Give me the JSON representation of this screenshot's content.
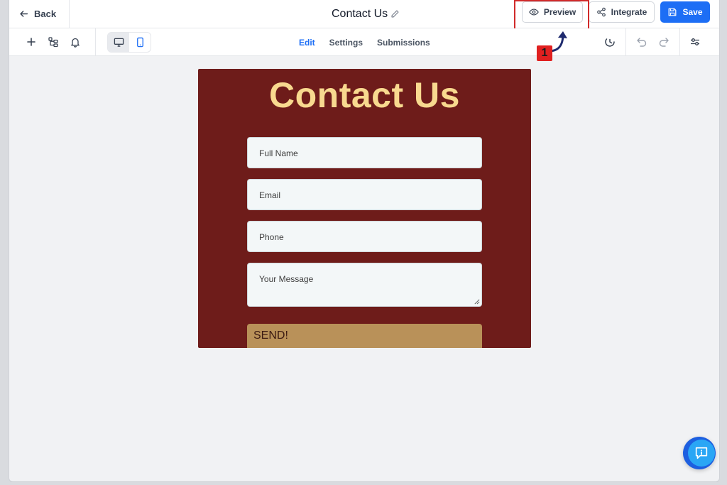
{
  "header": {
    "back_label": "Back",
    "form_title": "Contact Us",
    "preview_label": "Preview",
    "integrate_label": "Integrate",
    "save_label": "Save"
  },
  "toolbar": {
    "tabs": [
      {
        "label": "Edit",
        "active": true
      },
      {
        "label": "Settings",
        "active": false
      },
      {
        "label": "Submissions",
        "active": false
      }
    ],
    "device_mode": "desktop"
  },
  "form": {
    "heading": "Contact Us",
    "fields": [
      {
        "placeholder": "Full Name"
      },
      {
        "placeholder": "Email"
      },
      {
        "placeholder": "Phone"
      },
      {
        "placeholder": "Your Message"
      }
    ],
    "submit_label": "SEND!"
  },
  "annotation": {
    "step_number": "1"
  },
  "colors": {
    "accent": "#1d6ef5",
    "form_background": "#6e1c1a",
    "heading": "#f8d98f",
    "submit": "#b99159",
    "highlight": "#d12a2a"
  }
}
